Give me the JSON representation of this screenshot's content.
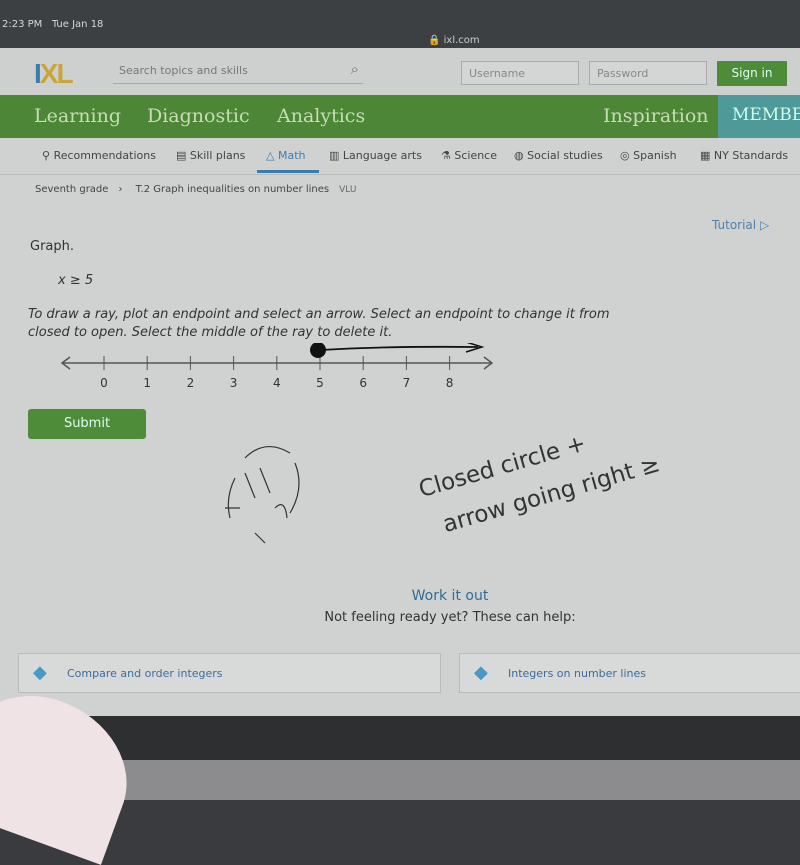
{
  "status_bar": {
    "time": "2:23 PM",
    "date": "Tue Jan 18",
    "url": "ixl.com"
  },
  "header": {
    "logo": "IXL",
    "search_placeholder": "Search topics and skills",
    "username_placeholder": "Username",
    "password_placeholder": "Password",
    "sign_in": "Sign in"
  },
  "nav": {
    "items": [
      "Learning",
      "Diagnostic",
      "Analytics",
      "Inspiration",
      "MEMBE"
    ]
  },
  "subnav": {
    "items": [
      "Recommendations",
      "Skill plans",
      "Math",
      "Language arts",
      "Science",
      "Social studies",
      "Spanish",
      "NY Standards"
    ],
    "active": "Math"
  },
  "breadcrumb": {
    "grade": "Seventh grade",
    "skill": "T.2 Graph inequalities on number lines",
    "code": "VLU"
  },
  "tutorial": "Tutorial",
  "question": {
    "prompt": "Graph.",
    "inequality": "x ≥ 5",
    "instructions_1": "To draw a ray, plot an endpoint and select an arrow. Select an endpoint to change it from",
    "instructions_2": "closed to open. Select the middle of the ray to delete it.",
    "ticks": [
      "0",
      "1",
      "2",
      "3",
      "4",
      "5",
      "6",
      "7",
      "8"
    ],
    "ray": {
      "endpoint": 5,
      "endpoint_type": "closed",
      "direction": "right"
    }
  },
  "submit": "Submit",
  "handwriting": {
    "line1": "Closed circle +",
    "line2": "arrow going right ≥"
  },
  "work": {
    "title": "Work it out",
    "subtitle": "Not feeling ready yet? These can help:"
  },
  "cards": [
    "Compare and order integers",
    "Integers on number lines"
  ],
  "colors": {
    "green": "#4d8636",
    "blue": "#3b7cb0",
    "teal": "#4f9a98"
  }
}
